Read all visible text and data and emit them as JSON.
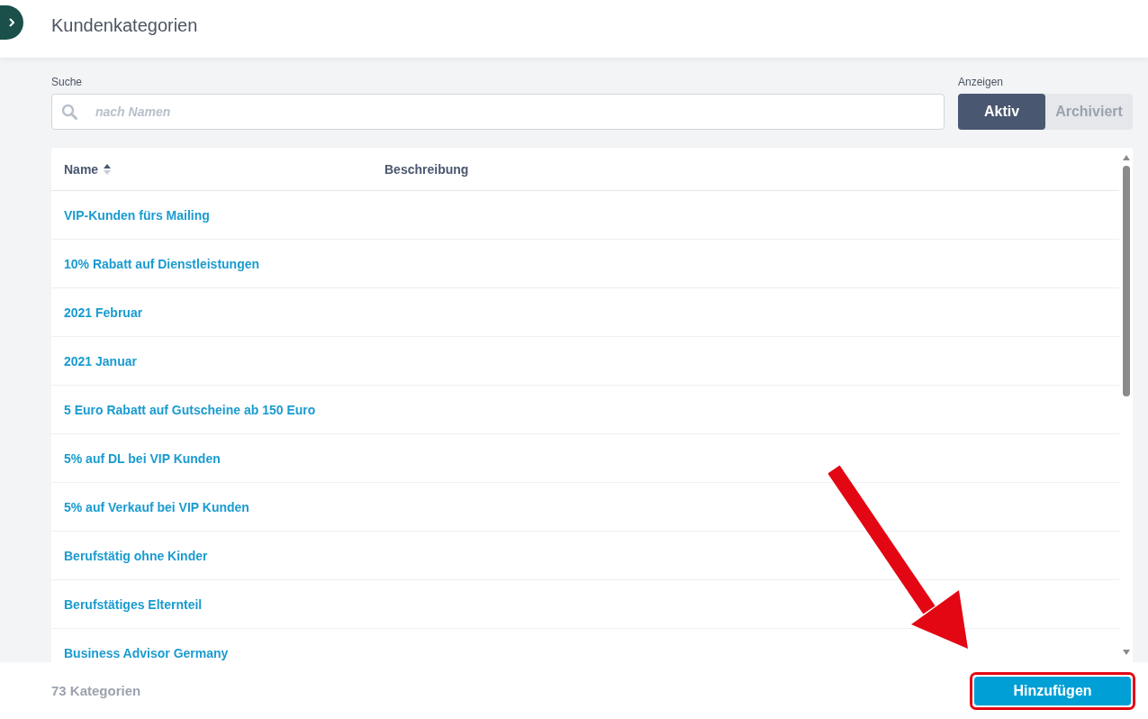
{
  "header": {
    "title": "Kundenkategorien"
  },
  "search": {
    "label": "Suche",
    "placeholder": "nach Namen"
  },
  "show": {
    "label": "Anzeigen",
    "options": [
      {
        "label": "Aktiv",
        "selected": true
      },
      {
        "label": "Archiviert",
        "selected": false
      }
    ]
  },
  "table": {
    "columns": [
      {
        "label": "Name",
        "sorted": true
      },
      {
        "label": "Beschreibung",
        "sorted": false
      }
    ],
    "rows": [
      {
        "name": "VIP-Kunden fürs Mailing"
      },
      {
        "name": "10% Rabatt auf Dienstleistungen"
      },
      {
        "name": "2021 Februar"
      },
      {
        "name": "2021 Januar"
      },
      {
        "name": "5 Euro Rabatt auf Gutscheine ab 150 Euro"
      },
      {
        "name": "5% auf DL bei VIP Kunden"
      },
      {
        "name": "5% auf Verkauf bei VIP Kunden"
      },
      {
        "name": "Berufstätig ohne Kinder"
      },
      {
        "name": "Berufstätiges Elternteil"
      },
      {
        "name": "Business Advisor Germany"
      }
    ]
  },
  "footer": {
    "count": "73 Kategorien",
    "add_button": {
      "label": "Hinzufügen",
      "highlighted": true
    }
  }
}
